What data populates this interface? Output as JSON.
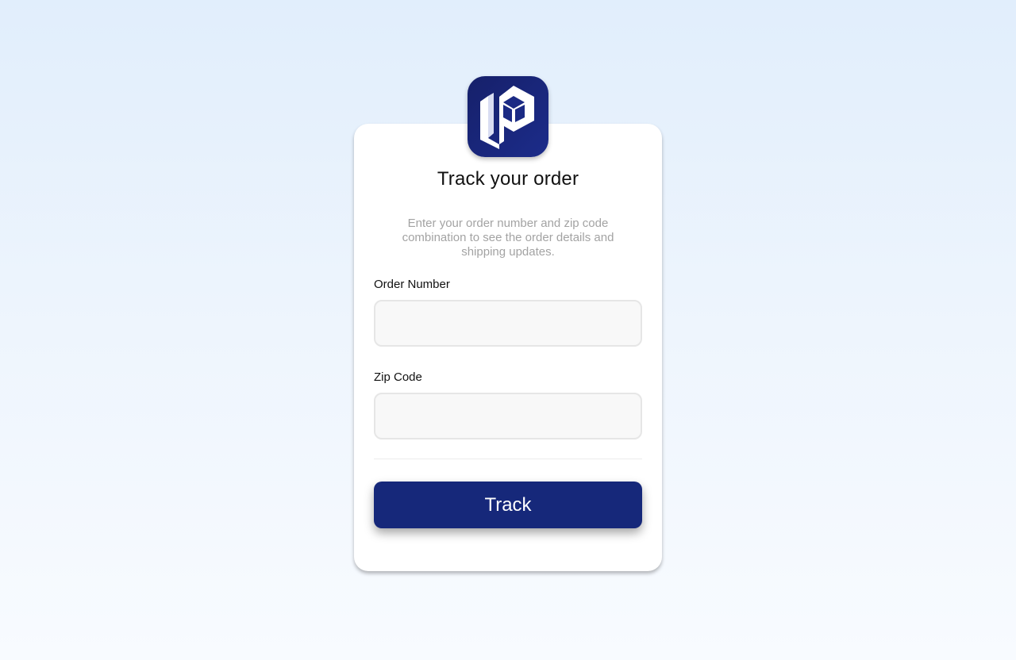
{
  "brand": {
    "logo_icon": "box-package-logo-icon",
    "logo_bg": "#16206a",
    "accent": "#16287a"
  },
  "form": {
    "title": "Track your order",
    "subtitle": "Enter your order number and zip code combination to see the order details and shipping updates.",
    "order_number": {
      "label": "Order Number",
      "value": "",
      "placeholder": ""
    },
    "zip_code": {
      "label": "Zip Code",
      "value": "",
      "placeholder": ""
    },
    "submit_label": "Track"
  }
}
